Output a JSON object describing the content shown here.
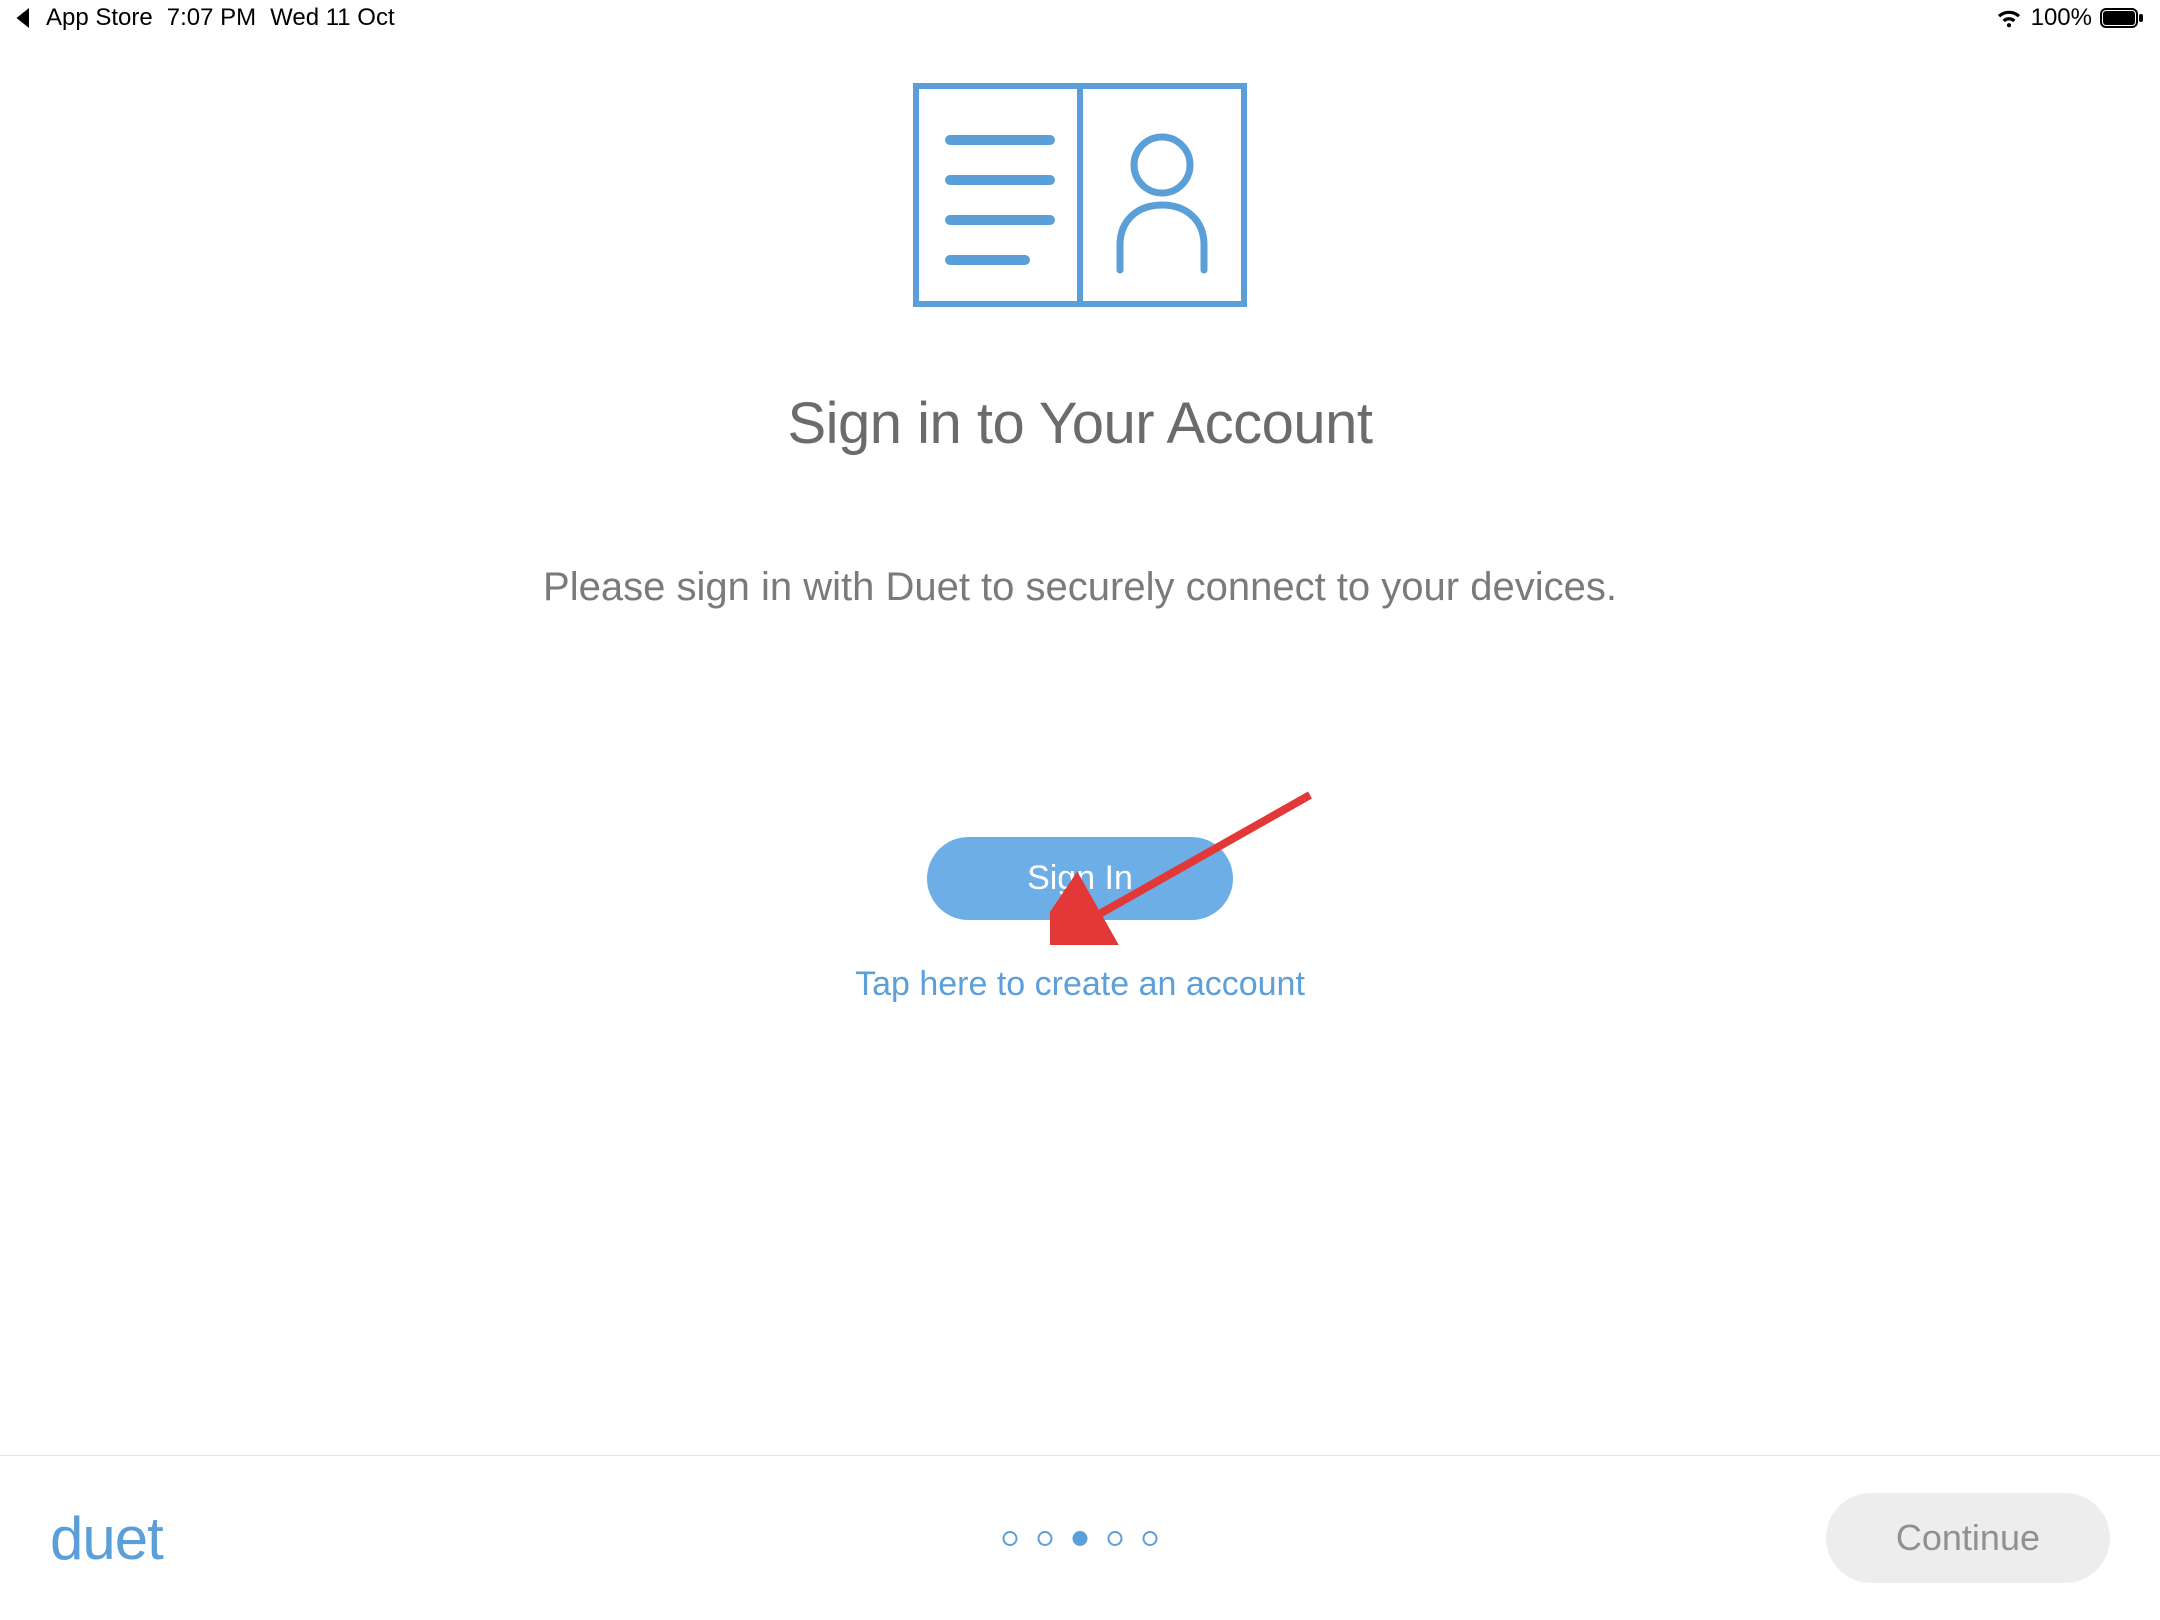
{
  "status_bar": {
    "back_label": "App Store",
    "time": "7:07 PM",
    "date": "Wed 11 Oct",
    "battery_percent": "100%"
  },
  "main": {
    "title": "Sign in to Your Account",
    "description": "Please sign in with Duet to securely connect to your devices.",
    "sign_in_label": "Sign In",
    "create_account_label": "Tap here to create an account"
  },
  "bottom_bar": {
    "logo": "duet",
    "continue_label": "Continue",
    "page_indicator": {
      "total": 5,
      "active_index": 2
    }
  },
  "colors": {
    "primary_blue": "#5b9fd8",
    "button_blue": "#6eaee6",
    "text_gray": "#6b6b6b",
    "light_gray": "#ededed"
  }
}
